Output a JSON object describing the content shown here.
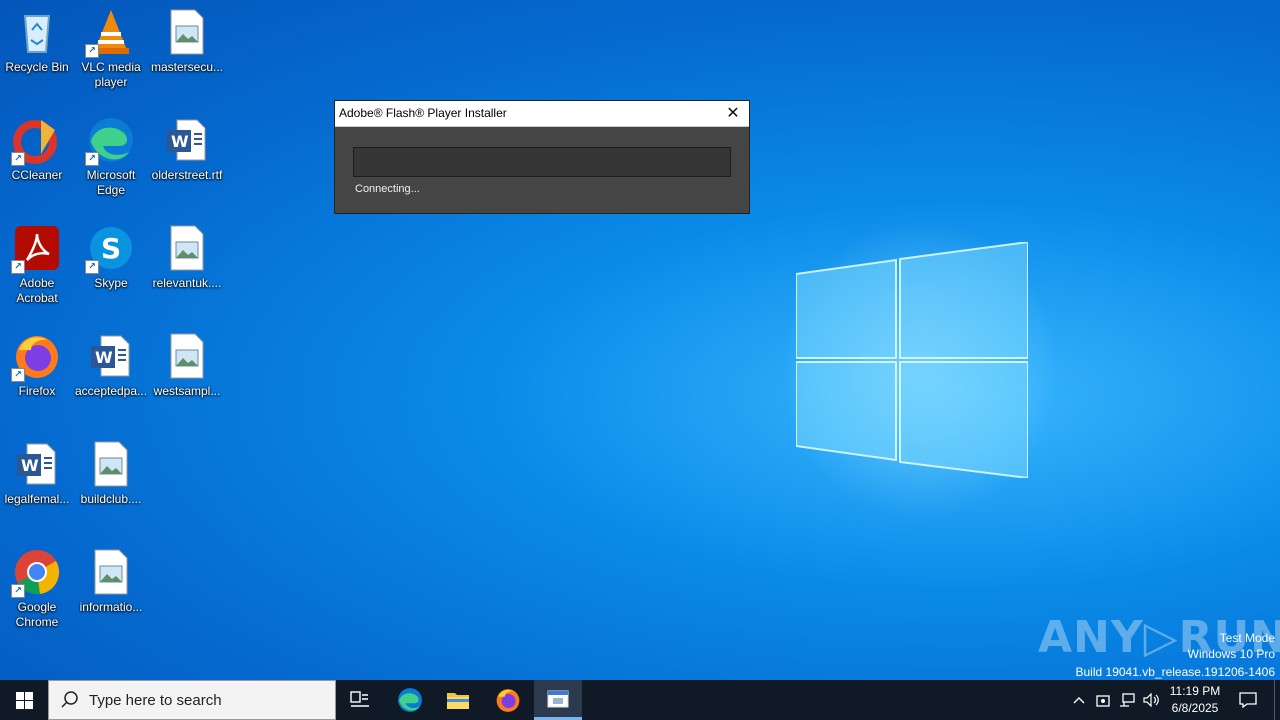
{
  "desktop": {
    "icons": [
      {
        "label": "Recycle Bin"
      },
      {
        "label": "VLC media player"
      },
      {
        "label": "mastersecu..."
      },
      {
        "label": "CCleaner"
      },
      {
        "label": "Microsoft Edge"
      },
      {
        "label": "olderstreet.rtf"
      },
      {
        "label": "Adobe Acrobat"
      },
      {
        "label": "Skype"
      },
      {
        "label": "relevantuk...."
      },
      {
        "label": "Firefox"
      },
      {
        "label": "acceptedpa..."
      },
      {
        "label": "westsampl..."
      },
      {
        "label": "legalfemal..."
      },
      {
        "label": "buildclub...."
      },
      {
        "label": "Google Chrome"
      },
      {
        "label": "informatio..."
      }
    ]
  },
  "dialog": {
    "title": "Adobe® Flash® Player Installer",
    "close_label": "✕",
    "progress_fraction": 0,
    "status": "Connecting..."
  },
  "watermark": {
    "brand": "ANY▷RUN",
    "line1": "Test Mode",
    "line2": "Windows 10 Pro",
    "line3": "Build 19041.vb_release.191206-1406"
  },
  "taskbar": {
    "search_placeholder": "Type here to search",
    "time": "11:19 PM",
    "date": "6/8/2025"
  },
  "colors": {
    "accent": "#0a8ae8",
    "taskbar": "#101a27",
    "dialog_bg": "#454545"
  }
}
